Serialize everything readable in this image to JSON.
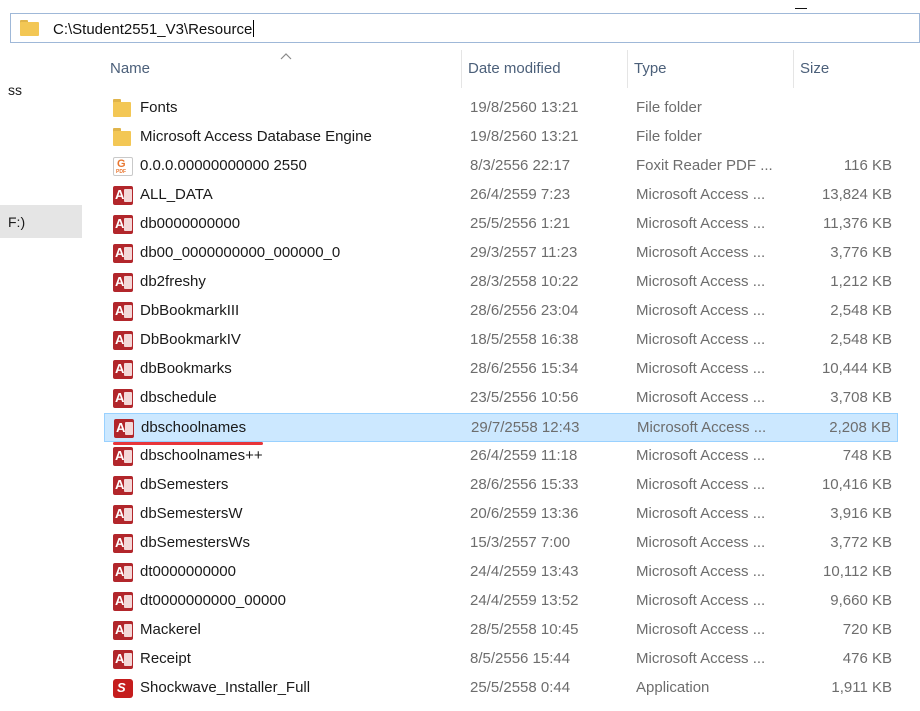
{
  "address": {
    "path": "C:\\Student2551_V3\\Resource"
  },
  "nav": {
    "fragment_1": "ss",
    "fragment_2": "F:)"
  },
  "columns": {
    "name": "Name",
    "date": "Date modified",
    "type": "Type",
    "size": "Size"
  },
  "colors": {
    "selection_bg": "#cce8ff",
    "selection_border": "#99d1ff",
    "annotation_underline": "#e8353a",
    "header_text": "#4c607a"
  },
  "files": [
    {
      "icon": "folder-icon",
      "name": "Fonts",
      "date": "19/8/2560 13:21",
      "type": "File folder",
      "size": ""
    },
    {
      "icon": "folder-icon",
      "name": "Microsoft Access Database Engine",
      "date": "19/8/2560 13:21",
      "type": "File folder",
      "size": ""
    },
    {
      "icon": "pdf-icon",
      "name": "0.0.0.00000000000 2550",
      "date": "8/3/2556 22:17",
      "type": "Foxit Reader PDF ...",
      "size": "116 KB"
    },
    {
      "icon": "access-icon",
      "name": "ALL_DATA",
      "date": "26/4/2559 7:23",
      "type": "Microsoft Access ...",
      "size": "13,824 KB"
    },
    {
      "icon": "access-icon",
      "name": "db0000000000",
      "date": "25/5/2556 1:21",
      "type": "Microsoft Access ...",
      "size": "11,376 KB"
    },
    {
      "icon": "access-icon",
      "name": "db00_0000000000_000000_0",
      "date": "29/3/2557 11:23",
      "type": "Microsoft Access ...",
      "size": "3,776 KB"
    },
    {
      "icon": "access-icon",
      "name": "db2freshy",
      "date": "28/3/2558 10:22",
      "type": "Microsoft Access ...",
      "size": "1,212 KB"
    },
    {
      "icon": "access-icon",
      "name": "DbBookmarkIII",
      "date": "28/6/2556 23:04",
      "type": "Microsoft Access ...",
      "size": "2,548 KB"
    },
    {
      "icon": "access-icon",
      "name": "DbBookmarkIV",
      "date": "18/5/2558 16:38",
      "type": "Microsoft Access ...",
      "size": "2,548 KB"
    },
    {
      "icon": "access-icon",
      "name": "dbBookmarks",
      "date": "28/6/2556 15:34",
      "type": "Microsoft Access ...",
      "size": "10,444 KB"
    },
    {
      "icon": "access-icon",
      "name": "dbschedule",
      "date": "23/5/2556 10:56",
      "type": "Microsoft Access ...",
      "size": "3,708 KB"
    },
    {
      "icon": "access-icon",
      "name": "dbschoolnames",
      "date": "29/7/2558 12:43",
      "type": "Microsoft Access ...",
      "size": "2,208 KB",
      "selected": true
    },
    {
      "icon": "access-icon",
      "name": "dbschoolnames++",
      "date": "26/4/2559 11:18",
      "type": "Microsoft Access ...",
      "size": "748 KB"
    },
    {
      "icon": "access-icon",
      "name": "dbSemesters",
      "date": "28/6/2556 15:33",
      "type": "Microsoft Access ...",
      "size": "10,416 KB"
    },
    {
      "icon": "access-icon",
      "name": "dbSemestersW",
      "date": "20/6/2559 13:36",
      "type": "Microsoft Access ...",
      "size": "3,916 KB"
    },
    {
      "icon": "access-icon",
      "name": "dbSemestersWs",
      "date": "15/3/2557 7:00",
      "type": "Microsoft Access ...",
      "size": "3,772 KB"
    },
    {
      "icon": "access-icon",
      "name": "dt0000000000",
      "date": "24/4/2559 13:43",
      "type": "Microsoft Access ...",
      "size": "10,112 KB"
    },
    {
      "icon": "access-icon",
      "name": "dt0000000000_00000",
      "date": "24/4/2559 13:52",
      "type": "Microsoft Access ...",
      "size": "9,660 KB"
    },
    {
      "icon": "access-icon",
      "name": "Mackerel",
      "date": "28/5/2558 10:45",
      "type": "Microsoft Access ...",
      "size": "720 KB"
    },
    {
      "icon": "access-icon",
      "name": "Receipt",
      "date": "8/5/2556 15:44",
      "type": "Microsoft Access ...",
      "size": "476 KB"
    },
    {
      "icon": "app-icon",
      "name": "Shockwave_Installer_Full",
      "date": "25/5/2558 0:44",
      "type": "Application",
      "size": "1,911 KB"
    }
  ]
}
